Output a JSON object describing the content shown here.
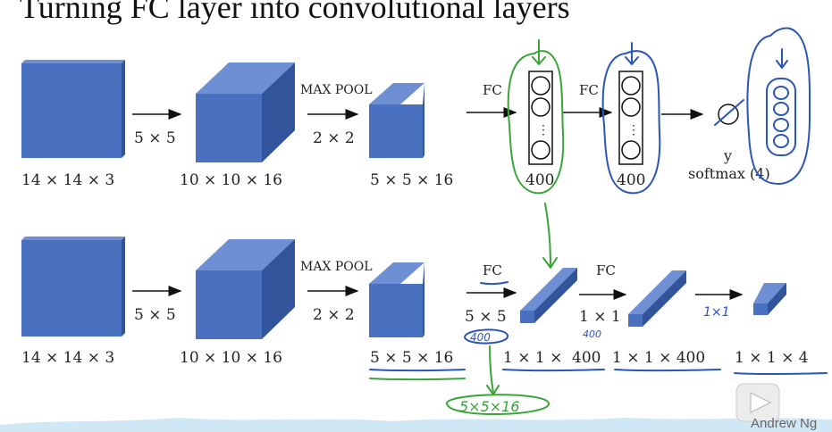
{
  "title": "Turning FC layer into convolutional layers",
  "row1": {
    "input_dims": "14 × 14 × 3",
    "conv_filter": "5 × 5",
    "conv_dims": "10 × 10 × 16",
    "pool_label": "MAX POOL",
    "pool_size": "2 × 2",
    "pool_dims": "5 × 5 × 16",
    "fc1_label": "FC",
    "fc1_units": "400",
    "fc2_label": "FC",
    "fc2_units": "400",
    "output_symbol": "y",
    "output_label": "softmax (4)",
    "dots": "⋮"
  },
  "row2": {
    "input_dims": "14 × 14 × 3",
    "conv_filter": "5 × 5",
    "conv_dims": "10 × 10 × 16",
    "pool_label": "MAX POOL",
    "pool_size": "2 × 2",
    "pool_dims": "5 × 5 × 16",
    "fc1_label": "FC",
    "fc1_filter": "5 × 5",
    "fc1_dims_prefix": "1 × 1 ×",
    "fc1_dims_value": "400",
    "fc2_label": "FC",
    "fc2_filter": "1 × 1",
    "fc2_dims": "1 × 1 × 400",
    "out_dims": "1 × 1 × 4"
  },
  "annotations": {
    "note_400_circle": "400",
    "note_400_small": "400",
    "note_1x1": "1×1",
    "note_5x5x16": "5×5×16"
  },
  "watermark": "Andrew Ng",
  "colors": {
    "box_front": "#4a70c0",
    "box_top": "#6f8fd4",
    "box_side": "#32549a",
    "pen_blue": "#2a56b8",
    "pen_green": "#3aa43a"
  }
}
